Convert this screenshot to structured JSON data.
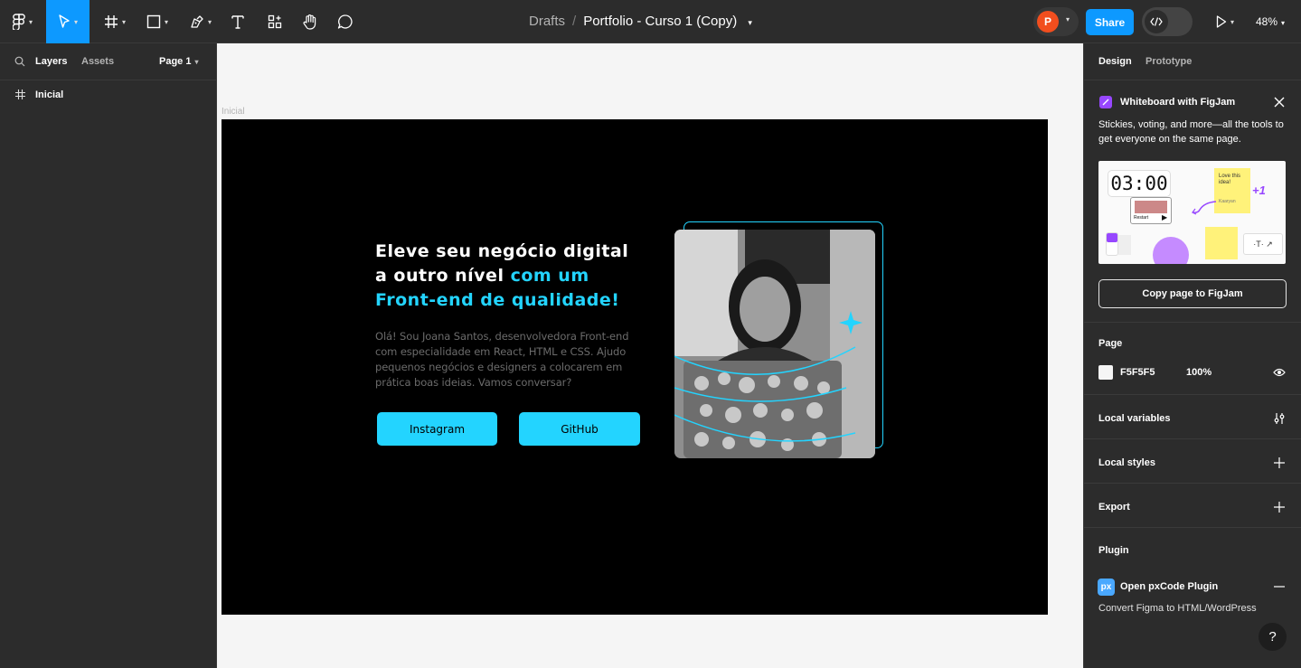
{
  "toolbar": {
    "breadcrumb_drafts": "Drafts",
    "breadcrumb_separator": "/",
    "file_name": "Portfolio - Curso 1 (Copy)",
    "avatar_initial": "P",
    "share_label": "Share",
    "zoom": "48%",
    "tools": [
      "figma-menu-icon",
      "move-tool-icon",
      "frame-tool-icon",
      "shape-tool-icon",
      "pen-tool-icon",
      "text-tool-icon",
      "resources-icon",
      "hand-tool-icon",
      "comment-icon"
    ]
  },
  "left_panel": {
    "tab_layers": "Layers",
    "tab_assets": "Assets",
    "page_selector": "Page 1",
    "layers": [
      {
        "label": "Inicial",
        "icon": "frame-icon"
      }
    ]
  },
  "canvas": {
    "frame_label": "Inicial",
    "headline_line1": "Eleve seu negócio digital",
    "headline_line2_white": "a outro nível ",
    "headline_line2_accent": "com um",
    "headline_line3": "Front-end de qualidade!",
    "paragraph": "Olá! Sou Joana Santos, desenvolvedora Front-end com especialidade em React, HTML e CSS. Ajudo pequenos negócios e designers a colocarem em prática boas ideias. Vamos conversar?",
    "button_instagram": "Instagram",
    "button_github": "GitHub",
    "accent_color": "#23d4ff",
    "frame_background": "#000000",
    "canvas_background": "#f5f5f5"
  },
  "right_panel": {
    "tab_design": "Design",
    "tab_prototype": "Prototype",
    "promo": {
      "title": "Whiteboard with FigJam",
      "body": "Stickies, voting, and more—all the tools to get everyone on the same page.",
      "timer": "03:00",
      "sticky_text": "Love this idea!",
      "sticky_author": "Kaaryan",
      "plus_one": "+1",
      "restart": "Restart",
      "copy_button": "Copy page to FigJam"
    },
    "page_section": {
      "title": "Page",
      "color_hex": "F5F5F5",
      "opacity": "100%"
    },
    "local_variables": "Local variables",
    "local_styles": "Local styles",
    "export": "Export",
    "plugin_section": {
      "title": "Plugin",
      "plugin_badge": "px",
      "plugin_name": "Open pxCode Plugin",
      "plugin_desc": "Convert Figma to HTML/WordPress"
    },
    "help": "?"
  }
}
